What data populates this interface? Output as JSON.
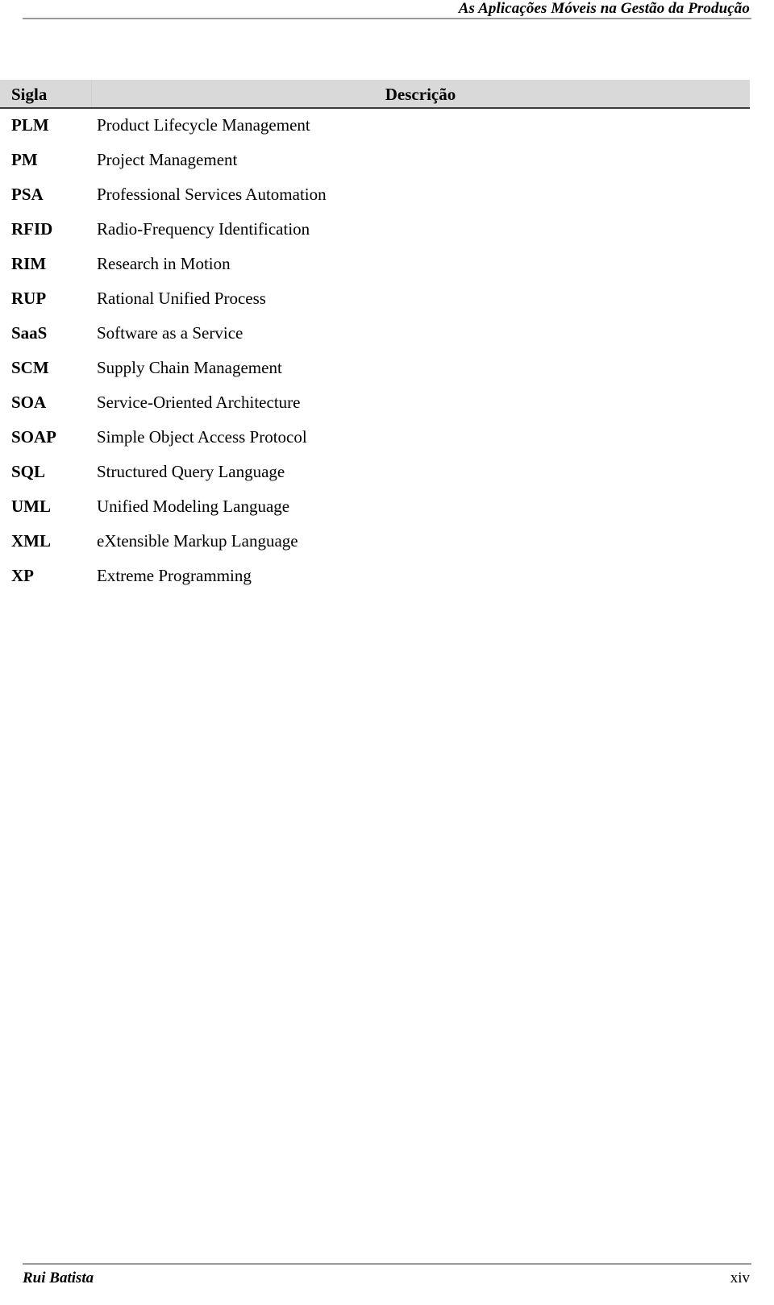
{
  "page_header": {
    "title": "As Aplicações Móveis na Gestão da Produção"
  },
  "table": {
    "columns": {
      "sigla": "Sigla",
      "descricao": "Descrição"
    },
    "header_background": "#d9d9d9",
    "rows": [
      {
        "sigla": "PLM",
        "descricao": "Product Lifecycle Management"
      },
      {
        "sigla": "PM",
        "descricao": "Project Management"
      },
      {
        "sigla": "PSA",
        "descricao": "Professional Services Automation"
      },
      {
        "sigla": "RFID",
        "descricao": "Radio-Frequency Identification"
      },
      {
        "sigla": "RIM",
        "descricao": "Research in Motion"
      },
      {
        "sigla": "RUP",
        "descricao": "Rational Unified Process"
      },
      {
        "sigla": "SaaS",
        "descricao": "Software as a Service"
      },
      {
        "sigla": "SCM",
        "descricao": "Supply Chain Management"
      },
      {
        "sigla": "SOA",
        "descricao": "Service-Oriented Architecture"
      },
      {
        "sigla": "SOAP",
        "descricao": "Simple Object Access Protocol"
      },
      {
        "sigla": "SQL",
        "descricao": "Structured Query Language"
      },
      {
        "sigla": "UML",
        "descricao": "Unified Modeling Language"
      },
      {
        "sigla": "XML",
        "descricao": "eXtensible Markup Language"
      },
      {
        "sigla": "XP",
        "descricao": "Extreme Programming"
      }
    ]
  },
  "page_footer": {
    "author": "Rui Batista",
    "page_number": "xiv"
  }
}
